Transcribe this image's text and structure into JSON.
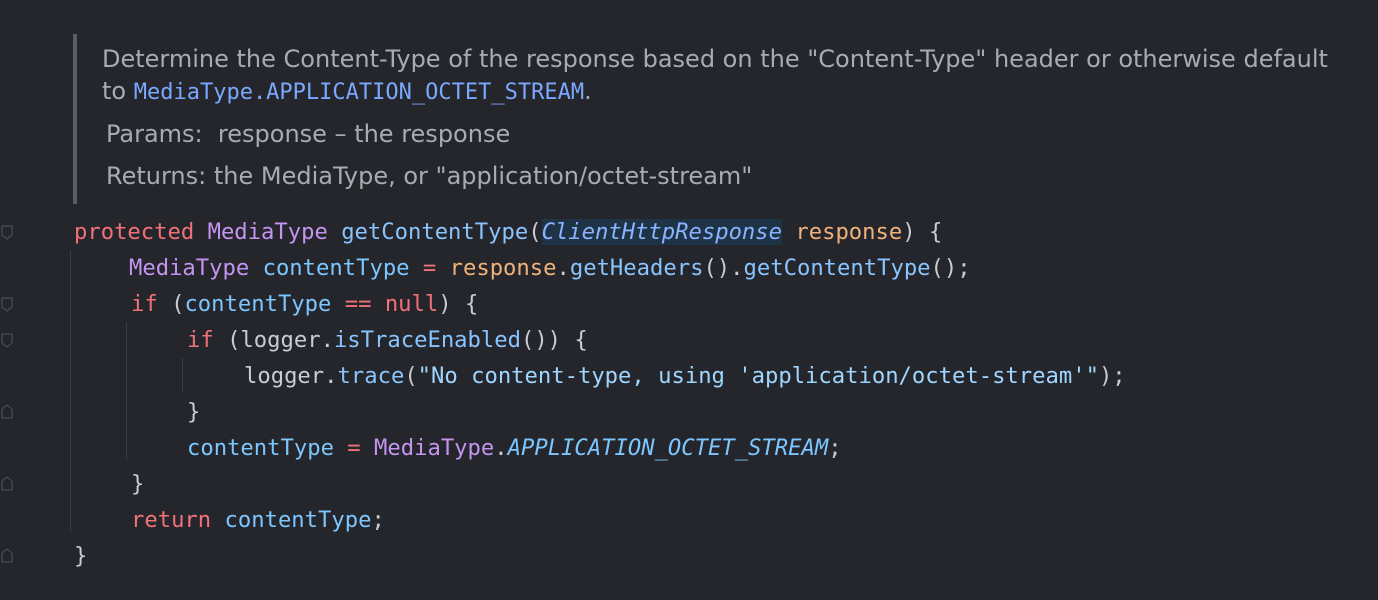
{
  "doc": {
    "description_text": "Determine the Content-Type of the response based on the \"Content-Type\" header or otherwise default to ",
    "description_link": "MediaType.APPLICATION_OCTET_STREAM",
    "description_end": ".",
    "params_label": "Params:",
    "params_value": "response – the response",
    "returns_label": "Returns:",
    "returns_value": "the MediaType, or \"application/octet-stream\""
  },
  "code": {
    "line1": {
      "kw_protected": "protected",
      "type_return": "MediaType",
      "method_name": "getContentType",
      "open_paren": "(",
      "param_type": "ClientHttpResponse",
      "param_name": "response",
      "close": ") {"
    },
    "line2": {
      "type": "MediaType",
      "var": "contentType",
      "eq": " = ",
      "recv": "response",
      "dot1": ".",
      "call1": "getHeaders",
      "mid": "().",
      "call2": "getContentType",
      "end": "();"
    },
    "line3": {
      "kw_if": "if",
      "open": " (",
      "var": "contentType",
      "op": " == ",
      "null": "null",
      "close": ") {"
    },
    "line4": {
      "kw_if": "if",
      "open": " (logger.",
      "call": "isTraceEnabled",
      "close": "()) {"
    },
    "line5": {
      "recv": "logger.",
      "call": "trace",
      "open": "(",
      "str": "\"No content-type, using 'application/octet-stream'\"",
      "close": ");"
    },
    "line6": {
      "brace": "}"
    },
    "line7": {
      "var": "contentType",
      "eq": " = ",
      "type": "MediaType",
      "dot": ".",
      "const": "APPLICATION_OCTET_STREAM",
      "semi": ";"
    },
    "line8": {
      "brace": "}"
    },
    "line9": {
      "kw_return": "return",
      "sp": " ",
      "var": "contentType",
      "semi": ";"
    },
    "line10": {
      "brace": "}"
    }
  },
  "colors": {
    "background": "#25262b",
    "keyword": "#f07178",
    "type": "#c394f0",
    "method": "#89c4ff",
    "parameter": "#f0b27a",
    "doc_text": "#a8abb2",
    "doc_link": "#7aa8ff"
  }
}
